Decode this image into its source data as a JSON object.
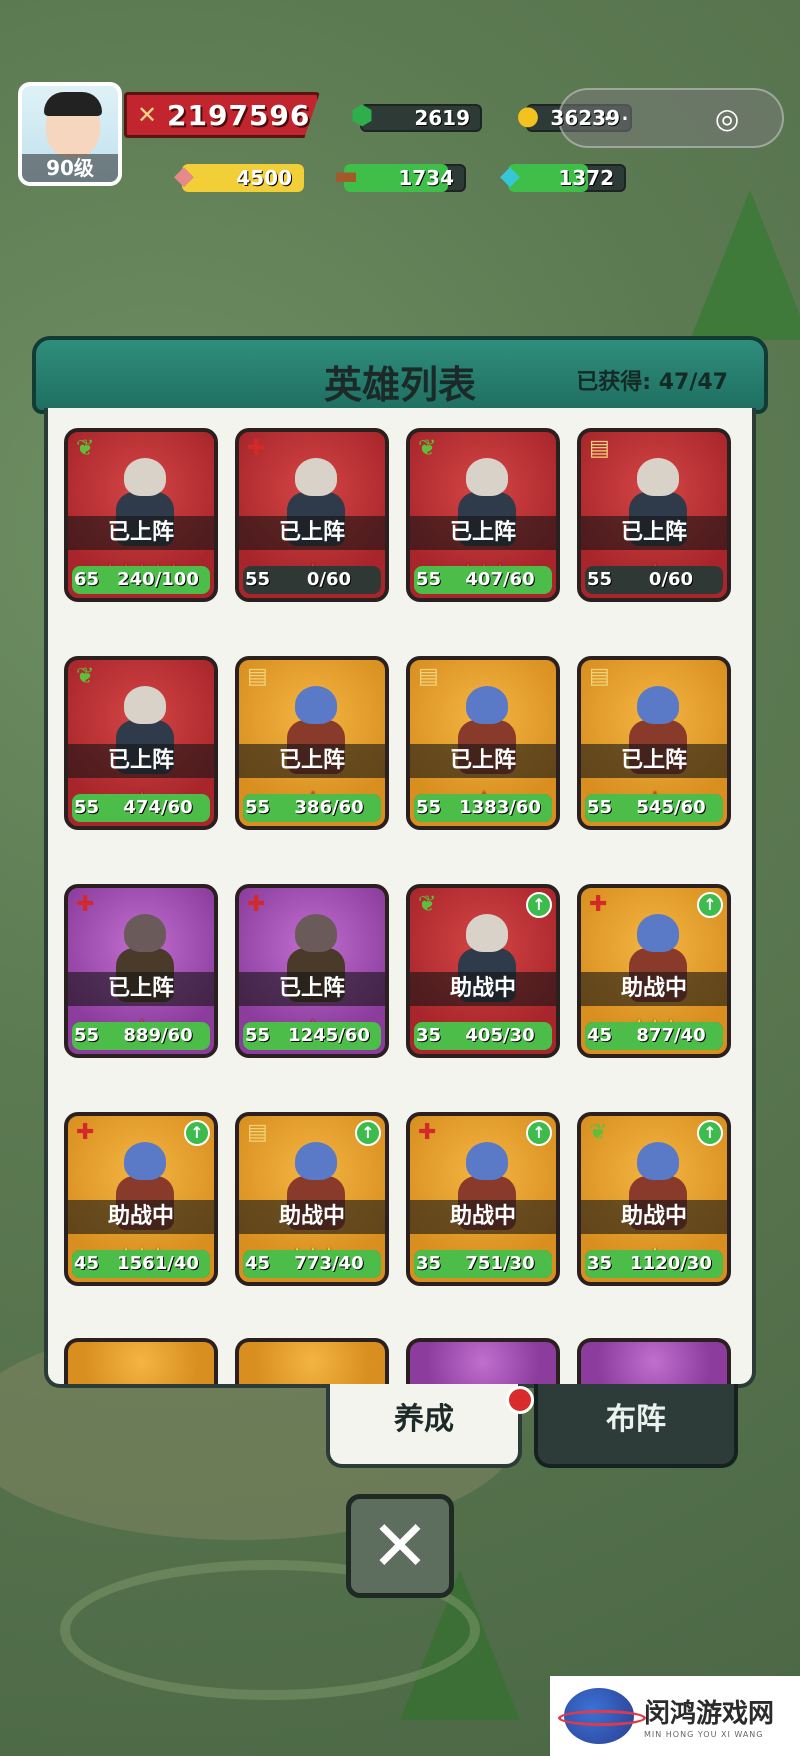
{
  "hud": {
    "level_label": "90级",
    "power": "2197596",
    "gems": "2619",
    "gold": "36239",
    "meat": "4500",
    "wood": "1734",
    "crystal": "1372",
    "menu_label": "···",
    "record_label": "◎"
  },
  "panel": {
    "title": "英雄列表",
    "count": "已获得: 47/47"
  },
  "heroes": [
    {
      "color": "red",
      "type": "leaf",
      "status": "已上阵",
      "stars": "★★★★★",
      "star_color": "red",
      "level": "65",
      "frag": "240/100",
      "progress": 1.0,
      "upgrade": false
    },
    {
      "color": "red",
      "type": "cross",
      "status": "已上阵",
      "stars": "★",
      "star_color": "red",
      "level": "55",
      "frag": "0/60",
      "progress": 0.0,
      "upgrade": false
    },
    {
      "color": "red",
      "type": "leaf",
      "status": "已上阵",
      "stars": "★★★",
      "star_color": "red",
      "level": "55",
      "frag": "407/60",
      "progress": 1.0,
      "upgrade": false
    },
    {
      "color": "red",
      "type": "book",
      "status": "已上阵",
      "stars": "★",
      "star_color": "red",
      "level": "55",
      "frag": "0/60",
      "progress": 0.0,
      "upgrade": false
    },
    {
      "color": "red",
      "type": "leaf",
      "status": "已上阵",
      "stars": "★",
      "star_color": "red",
      "level": "55",
      "frag": "474/60",
      "progress": 1.0,
      "upgrade": false
    },
    {
      "color": "orange",
      "type": "book",
      "status": "已上阵",
      "stars": "★",
      "star_color": "red",
      "level": "55",
      "frag": "386/60",
      "progress": 1.0,
      "upgrade": false
    },
    {
      "color": "orange",
      "type": "book",
      "status": "已上阵",
      "stars": "★",
      "star_color": "red",
      "level": "55",
      "frag": "1383/60",
      "progress": 1.0,
      "upgrade": false
    },
    {
      "color": "orange",
      "type": "book",
      "status": "已上阵",
      "stars": "★",
      "star_color": "red",
      "level": "55",
      "frag": "545/60",
      "progress": 1.0,
      "upgrade": false
    },
    {
      "color": "purple",
      "type": "cross",
      "status": "已上阵",
      "stars": "★",
      "star_color": "red",
      "level": "55",
      "frag": "889/60",
      "progress": 1.0,
      "upgrade": false
    },
    {
      "color": "purple",
      "type": "cross",
      "status": "已上阵",
      "stars": "★",
      "star_color": "red",
      "level": "55",
      "frag": "1245/60",
      "progress": 1.0,
      "upgrade": false
    },
    {
      "color": "red",
      "type": "leaf",
      "status": "助战中",
      "stars": "",
      "star_color": "red",
      "level": "35",
      "frag": "405/30",
      "progress": 1.0,
      "upgrade": true
    },
    {
      "color": "orange",
      "type": "cross",
      "status": "助战中",
      "stars": "★★★",
      "star_color": "gold",
      "level": "45",
      "frag": "877/40",
      "progress": 1.0,
      "upgrade": true
    },
    {
      "color": "orange",
      "type": "cross",
      "status": "助战中",
      "stars": "★★★",
      "star_color": "gold",
      "level": "45",
      "frag": "1561/40",
      "progress": 1.0,
      "upgrade": true
    },
    {
      "color": "orange",
      "type": "book",
      "status": "助战中",
      "stars": "★★★",
      "star_color": "gold",
      "level": "45",
      "frag": "773/40",
      "progress": 1.0,
      "upgrade": true
    },
    {
      "color": "orange",
      "type": "cross",
      "status": "助战中",
      "stars": "",
      "star_color": "gold",
      "level": "35",
      "frag": "751/30",
      "progress": 1.0,
      "upgrade": true
    },
    {
      "color": "orange",
      "type": "leaf",
      "status": "助战中",
      "stars": "★",
      "star_color": "gold",
      "level": "35",
      "frag": "1120/30",
      "progress": 1.0,
      "upgrade": true
    }
  ],
  "tabs": {
    "train": "养成",
    "formation": "布阵"
  },
  "close_label": "✕",
  "watermark": {
    "cn": "闵鸿游戏网",
    "en": "MIN HONG YOU XI WANG"
  }
}
